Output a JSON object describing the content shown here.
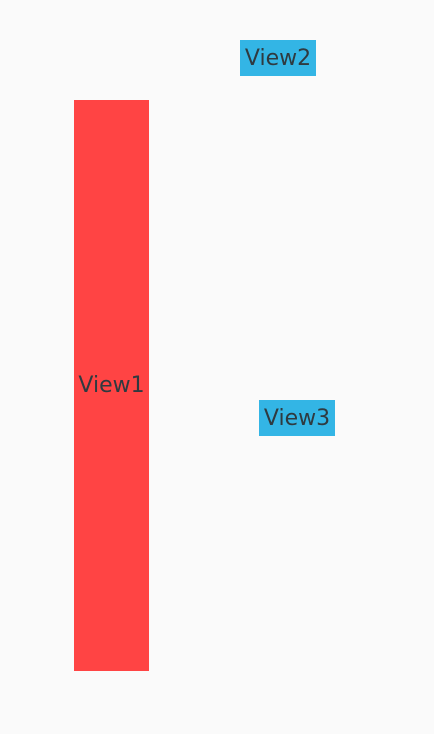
{
  "views": [
    {
      "id": "view1",
      "label": "View1",
      "color": "#ff4444"
    },
    {
      "id": "view2",
      "label": "View2",
      "color": "#33b5e5"
    },
    {
      "id": "view3",
      "label": "View3",
      "color": "#33b5e5"
    }
  ]
}
